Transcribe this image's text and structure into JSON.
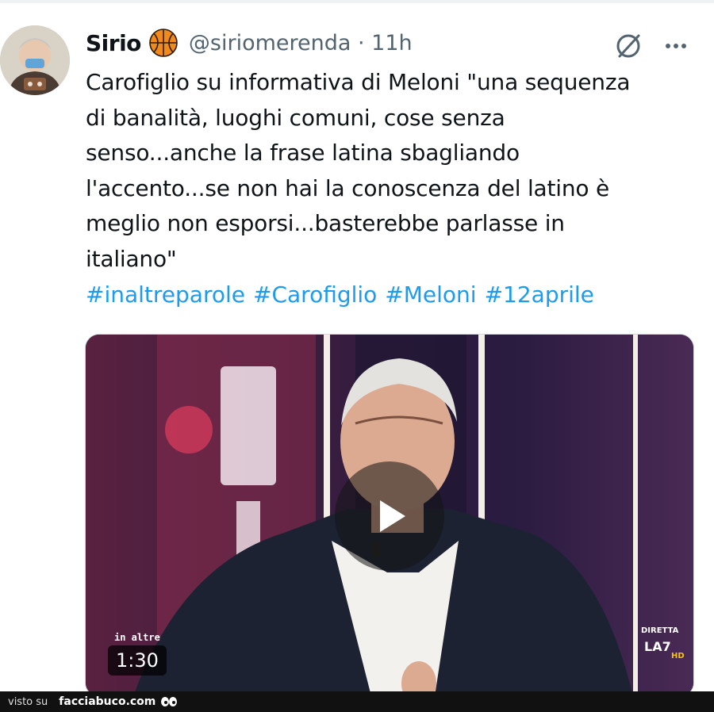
{
  "tweet": {
    "author_name": "Sirio",
    "handle_and_time": "@siriomerenda · 11h",
    "text_lines": [
      "Carofiglio su informativa di Meloni \"una sequenza",
      "di banalità, luoghi comuni, cose senza",
      "senso...anche la frase latina sbagliando",
      "l'accento...se non hai la conoscenza del latino è",
      "meglio non esporsi...basterebbe parlasse in",
      "italiano\""
    ],
    "hashtags": [
      "#inaltreparole",
      "#Carofiglio",
      "#Meloni",
      "#12aprile"
    ]
  },
  "media": {
    "duration": "1:30",
    "show_logo_text": "in altre",
    "channel_logo_text": "DIRETTA",
    "channel_logo_mark": "LA7",
    "channel_logo_sub": "HD"
  },
  "icons": {
    "badge": "basketball-icon",
    "grok": "grok-icon",
    "more": "more-icon",
    "play": "play-icon",
    "eyes": "eyes-icon"
  },
  "colors": {
    "text": "#0f1419",
    "secondary": "#536471",
    "link": "#1d9bf0",
    "badge": "#f08a1a"
  },
  "footer": {
    "visto_label": "visto su",
    "site_label": "facciabuco.com"
  }
}
